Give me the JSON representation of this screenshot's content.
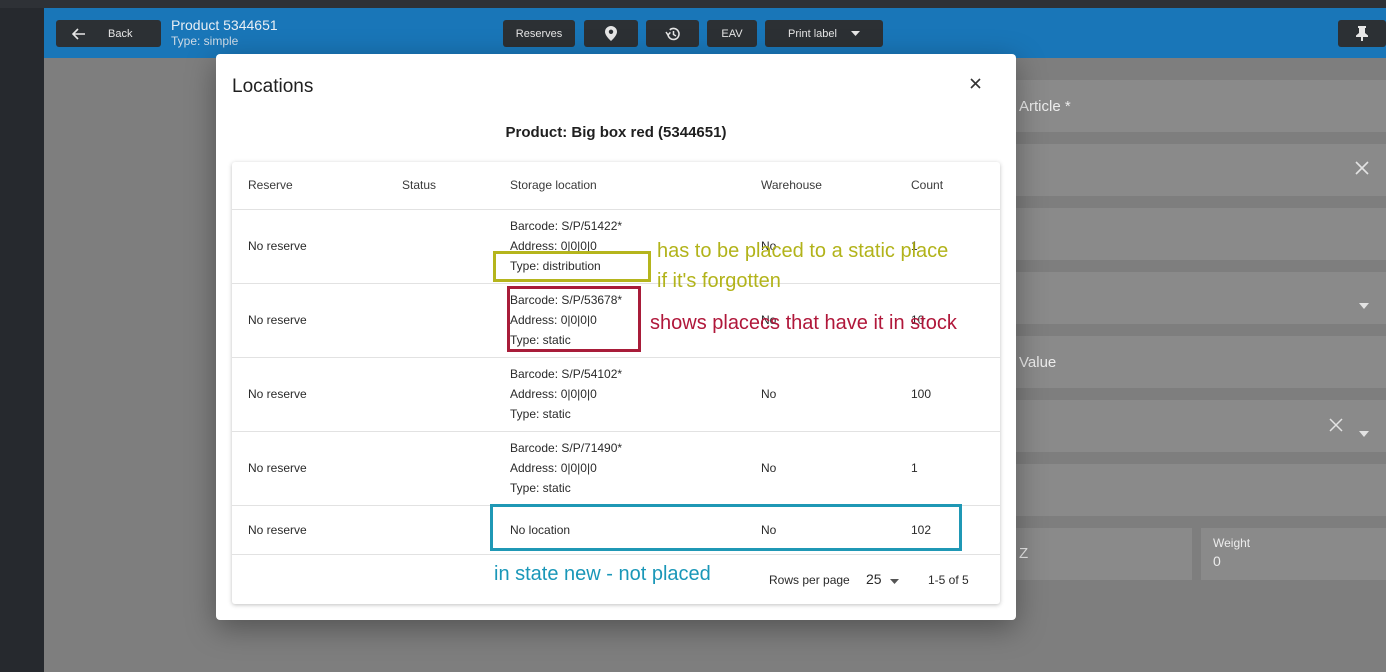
{
  "app_bar": {
    "back_label": "Back",
    "product_title": "Product 5344651",
    "product_type": "Type: simple",
    "reserves_label": "Reserves",
    "eav_label": "EAV",
    "print_label": "Print label"
  },
  "background_form": {
    "article_label": "Article *",
    "value_label": "Value",
    "z_label": "Z",
    "weight_label": "Weight",
    "weight_value": "0"
  },
  "modal": {
    "title": "Locations",
    "product_line": "Product: Big box red (5344651)",
    "columns": [
      "Reserve",
      "Status",
      "Storage location",
      "Warehouse",
      "Count"
    ],
    "rows": [
      {
        "reserve": "No reserve",
        "status": "",
        "barcode": "Barcode: S/P/51422*",
        "address": "Address: 0|0|0|0",
        "type": "Type: distribution",
        "warehouse": "No",
        "count": "1"
      },
      {
        "reserve": "No reserve",
        "status": "",
        "barcode": "Barcode: S/P/53678*",
        "address": "Address: 0|0|0|0",
        "type": "Type: static",
        "warehouse": "No",
        "count": "10"
      },
      {
        "reserve": "No reserve",
        "status": "",
        "barcode": "Barcode: S/P/54102*",
        "address": "Address: 0|0|0|0",
        "type": "Type: static",
        "warehouse": "No",
        "count": "100"
      },
      {
        "reserve": "No reserve",
        "status": "",
        "barcode": "Barcode: S/P/71490*",
        "address": "Address: 0|0|0|0",
        "type": "Type: static",
        "warehouse": "No",
        "count": "1"
      },
      {
        "reserve": "No reserve",
        "status": "",
        "location": "No location",
        "warehouse": "No",
        "count": "102"
      }
    ],
    "pagination": {
      "rows_per_page_label": "Rows per page",
      "rows_per_page_value": "25",
      "range": "1-5 of 5"
    }
  },
  "annotations": {
    "olive_note_line1": "has to be placed to a static place",
    "olive_note_line2": "if it's forgotten",
    "red_note": "shows placecs that have it in stock",
    "teal_note": "in state new - not placed",
    "colors": {
      "olive": "#b5b51d",
      "red": "#a81c39",
      "teal": "#1f98b5"
    }
  },
  "icons": [
    "arrow-left-icon",
    "location-pin-icon",
    "history-icon",
    "caret-down-icon",
    "pin-icon",
    "close-icon"
  ],
  "colors": {
    "app_bar": "#1976b8",
    "button": "#2c3034",
    "backdrop": "#7e7e7e"
  }
}
